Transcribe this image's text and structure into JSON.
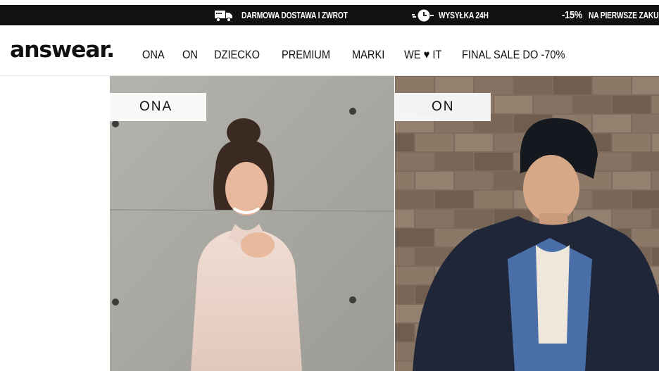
{
  "promo": {
    "items": [
      {
        "icon": "truck-icon",
        "text": "DARMOWA DOSTAWA I ZWROT"
      },
      {
        "icon": "clock-icon",
        "text": "WYSYŁKA 24H"
      },
      {
        "percent": "-15%",
        "text": "NA PIERWSZE ZAKUPY"
      }
    ]
  },
  "header": {
    "logo": "answear.",
    "nav": [
      "ONA",
      "ON",
      "DZIECKO",
      "PREMIUM",
      "MARKI",
      "WE ♥ IT",
      "FINAL SALE DO -70%"
    ]
  },
  "hero": {
    "left_label": "ONA",
    "right_label": "ON"
  },
  "colors": {
    "promo_bg": "#111111",
    "concrete": "#a9a8a2",
    "brick": "#8a7563",
    "sweater_pink": "#ecd6cc",
    "jacket_navy": "#1e2638",
    "shirt_blue": "#4a6fa8"
  }
}
